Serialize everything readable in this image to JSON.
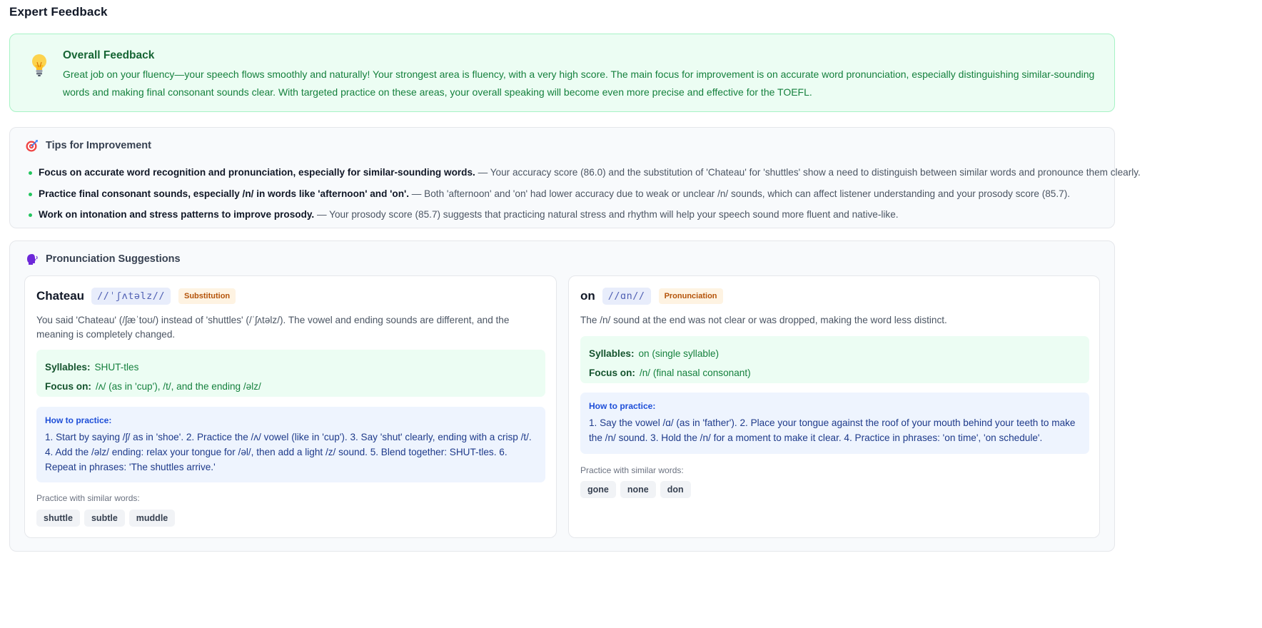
{
  "page": {
    "title": "Expert Feedback"
  },
  "overall": {
    "heading": "Overall Feedback",
    "icon": "lightbulb-icon",
    "text": "Great job on your fluency—your speech flows smoothly and naturally! Your strongest area is fluency, with a very high score. The main focus for improvement is on accurate word pronunciation, especially distinguishing similar-sounding words and making final consonant sounds clear. With targeted practice on these areas, your overall speaking will become even more precise and effective for the TOEFL."
  },
  "tips": {
    "heading": "Tips for Improvement",
    "icon": "target-icon",
    "items": [
      {
        "bold": "Focus on accurate word recognition and pronunciation, especially for similar-sounding words.",
        "rest": " — Your accuracy score (86.0) and the substitution of 'Chateau' for 'shuttles' show a need to distinguish between similar words and pronounce them clearly."
      },
      {
        "bold": "Practice final consonant sounds, especially /n/ in words like 'afternoon' and 'on'.",
        "rest": " — Both 'afternoon' and 'on' had lower accuracy due to weak or unclear /n/ sounds, which can affect listener understanding and your prosody score (85.7)."
      },
      {
        "bold": "Work on intonation and stress patterns to improve prosody.",
        "rest": " — Your prosody score (85.7) suggests that practicing natural stress and rhythm will help your speech sound more fluent and native-like."
      }
    ]
  },
  "pronunciation": {
    "heading": "Pronunciation Suggestions",
    "icon": "speaking-head-icon",
    "cards": [
      {
        "word": "Chateau",
        "ipa": "//ˈʃʌtəlz//",
        "badge": "Substitution",
        "description": "You said 'Chateau' (/ʃæˈtoʊ/) instead of 'shuttles' (/ˈʃʌtəlz/). The vowel and ending sounds are different, and the meaning is completely changed.",
        "syllables_label": "Syllables:",
        "syllables": "SHUT-tles",
        "focus_label": "Focus on:",
        "focus": "/ʌ/ (as in 'cup'), /t/, and the ending /əlz/",
        "practice_label": "How to practice:",
        "practice": "1. Start by saying /ʃ/ as in 'shoe'. 2. Practice the /ʌ/ vowel (like in 'cup'). 3. Say 'shut' clearly, ending with a crisp /t/. 4. Add the /əlz/ ending: relax your tongue for /əl/, then add a light /z/ sound. 5. Blend together: SHUT-tles. 6. Repeat in phrases: 'The shuttles arrive.'",
        "similar_label": "Practice with similar words:",
        "similar": [
          "shuttle",
          "subtle",
          "muddle"
        ]
      },
      {
        "word": "on",
        "ipa": "//ɑn//",
        "badge": "Pronunciation",
        "description": "The /n/ sound at the end was not clear or was dropped, making the word less distinct.",
        "syllables_label": "Syllables:",
        "syllables": "on (single syllable)",
        "focus_label": "Focus on:",
        "focus": "/n/ (final nasal consonant)",
        "practice_label": "How to practice:",
        "practice": "1. Say the vowel /ɑ/ (as in 'father'). 2. Place your tongue against the roof of your mouth behind your teeth to make the /n/ sound. 3. Hold the /n/ for a moment to make it clear. 4. Practice in phrases: 'on time', 'on schedule'.",
        "similar_label": "Practice with similar words:",
        "similar": [
          "gone",
          "none",
          "don"
        ]
      }
    ]
  },
  "colors": {
    "success": "#15803d",
    "badge": "#b45309",
    "info": "#1d4ed8"
  }
}
